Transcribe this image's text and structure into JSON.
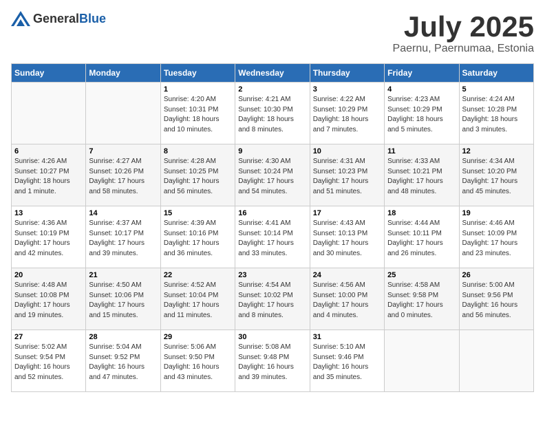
{
  "header": {
    "logo_general": "General",
    "logo_blue": "Blue",
    "title": "July 2025",
    "subtitle": "Paernu, Paernumaa, Estonia"
  },
  "days_of_week": [
    "Sunday",
    "Monday",
    "Tuesday",
    "Wednesday",
    "Thursday",
    "Friday",
    "Saturday"
  ],
  "weeks": [
    [
      {
        "day": "",
        "info": ""
      },
      {
        "day": "",
        "info": ""
      },
      {
        "day": "1",
        "info": "Sunrise: 4:20 AM\nSunset: 10:31 PM\nDaylight: 18 hours\nand 10 minutes."
      },
      {
        "day": "2",
        "info": "Sunrise: 4:21 AM\nSunset: 10:30 PM\nDaylight: 18 hours\nand 8 minutes."
      },
      {
        "day": "3",
        "info": "Sunrise: 4:22 AM\nSunset: 10:29 PM\nDaylight: 18 hours\nand 7 minutes."
      },
      {
        "day": "4",
        "info": "Sunrise: 4:23 AM\nSunset: 10:29 PM\nDaylight: 18 hours\nand 5 minutes."
      },
      {
        "day": "5",
        "info": "Sunrise: 4:24 AM\nSunset: 10:28 PM\nDaylight: 18 hours\nand 3 minutes."
      }
    ],
    [
      {
        "day": "6",
        "info": "Sunrise: 4:26 AM\nSunset: 10:27 PM\nDaylight: 18 hours\nand 1 minute."
      },
      {
        "day": "7",
        "info": "Sunrise: 4:27 AM\nSunset: 10:26 PM\nDaylight: 17 hours\nand 58 minutes."
      },
      {
        "day": "8",
        "info": "Sunrise: 4:28 AM\nSunset: 10:25 PM\nDaylight: 17 hours\nand 56 minutes."
      },
      {
        "day": "9",
        "info": "Sunrise: 4:30 AM\nSunset: 10:24 PM\nDaylight: 17 hours\nand 54 minutes."
      },
      {
        "day": "10",
        "info": "Sunrise: 4:31 AM\nSunset: 10:23 PM\nDaylight: 17 hours\nand 51 minutes."
      },
      {
        "day": "11",
        "info": "Sunrise: 4:33 AM\nSunset: 10:21 PM\nDaylight: 17 hours\nand 48 minutes."
      },
      {
        "day": "12",
        "info": "Sunrise: 4:34 AM\nSunset: 10:20 PM\nDaylight: 17 hours\nand 45 minutes."
      }
    ],
    [
      {
        "day": "13",
        "info": "Sunrise: 4:36 AM\nSunset: 10:19 PM\nDaylight: 17 hours\nand 42 minutes."
      },
      {
        "day": "14",
        "info": "Sunrise: 4:37 AM\nSunset: 10:17 PM\nDaylight: 17 hours\nand 39 minutes."
      },
      {
        "day": "15",
        "info": "Sunrise: 4:39 AM\nSunset: 10:16 PM\nDaylight: 17 hours\nand 36 minutes."
      },
      {
        "day": "16",
        "info": "Sunrise: 4:41 AM\nSunset: 10:14 PM\nDaylight: 17 hours\nand 33 minutes."
      },
      {
        "day": "17",
        "info": "Sunrise: 4:43 AM\nSunset: 10:13 PM\nDaylight: 17 hours\nand 30 minutes."
      },
      {
        "day": "18",
        "info": "Sunrise: 4:44 AM\nSunset: 10:11 PM\nDaylight: 17 hours\nand 26 minutes."
      },
      {
        "day": "19",
        "info": "Sunrise: 4:46 AM\nSunset: 10:09 PM\nDaylight: 17 hours\nand 23 minutes."
      }
    ],
    [
      {
        "day": "20",
        "info": "Sunrise: 4:48 AM\nSunset: 10:08 PM\nDaylight: 17 hours\nand 19 minutes."
      },
      {
        "day": "21",
        "info": "Sunrise: 4:50 AM\nSunset: 10:06 PM\nDaylight: 17 hours\nand 15 minutes."
      },
      {
        "day": "22",
        "info": "Sunrise: 4:52 AM\nSunset: 10:04 PM\nDaylight: 17 hours\nand 11 minutes."
      },
      {
        "day": "23",
        "info": "Sunrise: 4:54 AM\nSunset: 10:02 PM\nDaylight: 17 hours\nand 8 minutes."
      },
      {
        "day": "24",
        "info": "Sunrise: 4:56 AM\nSunset: 10:00 PM\nDaylight: 17 hours\nand 4 minutes."
      },
      {
        "day": "25",
        "info": "Sunrise: 4:58 AM\nSunset: 9:58 PM\nDaylight: 17 hours\nand 0 minutes."
      },
      {
        "day": "26",
        "info": "Sunrise: 5:00 AM\nSunset: 9:56 PM\nDaylight: 16 hours\nand 56 minutes."
      }
    ],
    [
      {
        "day": "27",
        "info": "Sunrise: 5:02 AM\nSunset: 9:54 PM\nDaylight: 16 hours\nand 52 minutes."
      },
      {
        "day": "28",
        "info": "Sunrise: 5:04 AM\nSunset: 9:52 PM\nDaylight: 16 hours\nand 47 minutes."
      },
      {
        "day": "29",
        "info": "Sunrise: 5:06 AM\nSunset: 9:50 PM\nDaylight: 16 hours\nand 43 minutes."
      },
      {
        "day": "30",
        "info": "Sunrise: 5:08 AM\nSunset: 9:48 PM\nDaylight: 16 hours\nand 39 minutes."
      },
      {
        "day": "31",
        "info": "Sunrise: 5:10 AM\nSunset: 9:46 PM\nDaylight: 16 hours\nand 35 minutes."
      },
      {
        "day": "",
        "info": ""
      },
      {
        "day": "",
        "info": ""
      }
    ]
  ]
}
